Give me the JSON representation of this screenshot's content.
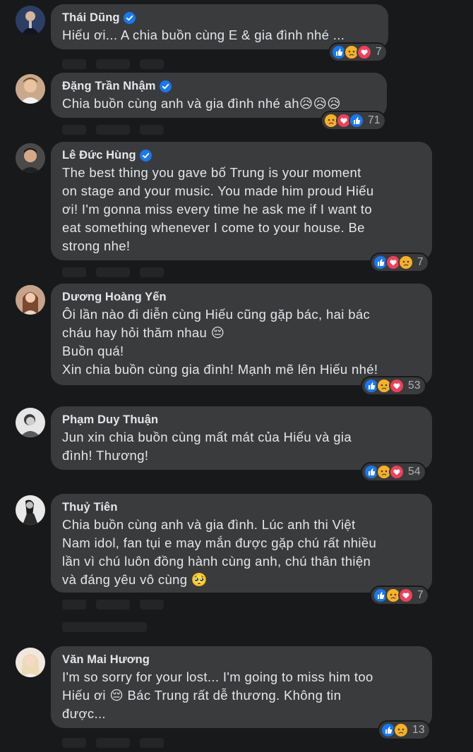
{
  "comments": [
    {
      "author": "Thái Dũng",
      "verified": true,
      "text": "Hiếu ơi... A chia buồn cùng E & gia đình nhé ...",
      "reactions": [
        "like",
        "sad",
        "love"
      ],
      "count": "7"
    },
    {
      "author": "Đặng Trần Nhậm",
      "verified": true,
      "text": "Chia buồn cùng anh và gia đình nhé ah😥😥😥",
      "reactions": [
        "sad",
        "love",
        "like"
      ],
      "count": "71"
    },
    {
      "author": "Lê Đức Hùng",
      "verified": true,
      "text": "The best thing you gave bố Trung is your moment\non stage and your music. You made him proud Hiếu\nơi! I'm gonna miss every time he ask me if I want to\neat something whenever I come to your house. Be\nstrong nhe!",
      "reactions": [
        "like",
        "love",
        "sad"
      ],
      "count": "7"
    },
    {
      "author": "Dương Hoàng Yến",
      "verified": false,
      "text": "Ôi lần nào đi diễn cùng Hiếu cũng gặp bác, hai bác\ncháu hay hỏi thăm nhau 😔\nBuồn quá!\nXin chia buồn cùng gia đình! Mạnh mẽ lên Hiếu nhé!",
      "reactions": [
        "like",
        "sad",
        "love"
      ],
      "count": "53"
    },
    {
      "author": "Phạm Duy Thuận",
      "verified": false,
      "text": "Jun xin chia buồn cùng mất mát của Hiếu và gia\nđình! Thương!",
      "reactions": [
        "like",
        "sad",
        "love"
      ],
      "count": "54"
    },
    {
      "author": "Thuỷ Tiên",
      "verified": false,
      "text": "Chia buồn cùng anh và gia đình. Lúc anh thi Việt\nNam idol, fan tụi e may mắn được gặp chú rất nhiều\nlần vì chú luôn đồng hành cùng anh, chú thân thiện\nvà đáng yêu vô cùng 🥺",
      "reactions": [
        "like",
        "sad",
        "love"
      ],
      "count": "7"
    },
    {
      "author": "Văn Mai Hương",
      "verified": false,
      "text": "I'm so sorry for your lost... I'm going to miss him too\nHiếu ơi 😔 Bác Trung rất dễ thương. Không tin\nđược...",
      "reactions": [
        "like",
        "sad"
      ],
      "count": "13"
    }
  ],
  "colors": {
    "background": "#18191a",
    "bubble": "#3a3b3c",
    "text": "#e4e6eb",
    "muted": "#b0b3b8",
    "like": "#1877f2",
    "love": "#f33e58",
    "sad": "#f7b125"
  }
}
